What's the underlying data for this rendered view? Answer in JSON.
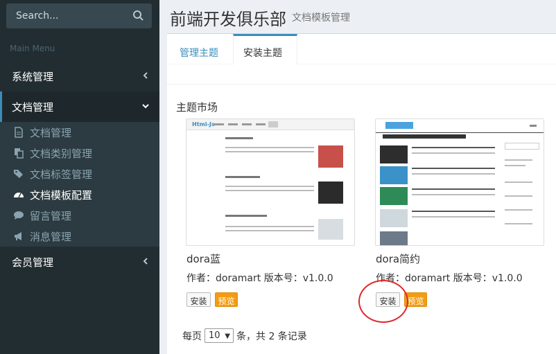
{
  "sidebar": {
    "search_placeholder": "Search...",
    "menu_header": "Main Menu",
    "items": [
      {
        "label": "系统管理"
      },
      {
        "label": "文档管理"
      },
      {
        "label": "会员管理"
      }
    ],
    "sub_items": [
      {
        "label": "文档管理",
        "icon": "file-icon"
      },
      {
        "label": "文档类别管理",
        "icon": "copy-icon"
      },
      {
        "label": "文档标签管理",
        "icon": "tags-icon"
      },
      {
        "label": "文档模板配置",
        "icon": "dashboard-icon"
      },
      {
        "label": "留言管理",
        "icon": "comments-icon"
      },
      {
        "label": "消息管理",
        "icon": "bullhorn-icon"
      }
    ]
  },
  "header": {
    "title": "前端开发俱乐部",
    "subtitle": "文档模板管理"
  },
  "tabs": [
    {
      "label": "管理主题"
    },
    {
      "label": "安装主题"
    }
  ],
  "market": {
    "title": "主题市场",
    "themes": [
      {
        "name": "dora蓝",
        "meta": "作者：doramart 版本号：v1.0.0",
        "install_label": "安装",
        "preview_label": "预览",
        "thumb_logo": "Html-Js"
      },
      {
        "name": "dora简约",
        "meta": "作者：doramart 版本号：v1.0.0",
        "install_label": "安装",
        "preview_label": "预览",
        "thumb_logo": ""
      }
    ]
  },
  "pager": {
    "prefix": "每页",
    "per_page": "10",
    "suffix": "条，共 2 条记录"
  },
  "colors": {
    "sidebar_bg": "#222d32",
    "accent": "#3c8dbc",
    "preview_btn": "#f39c12",
    "annotation": "#e0262b"
  }
}
